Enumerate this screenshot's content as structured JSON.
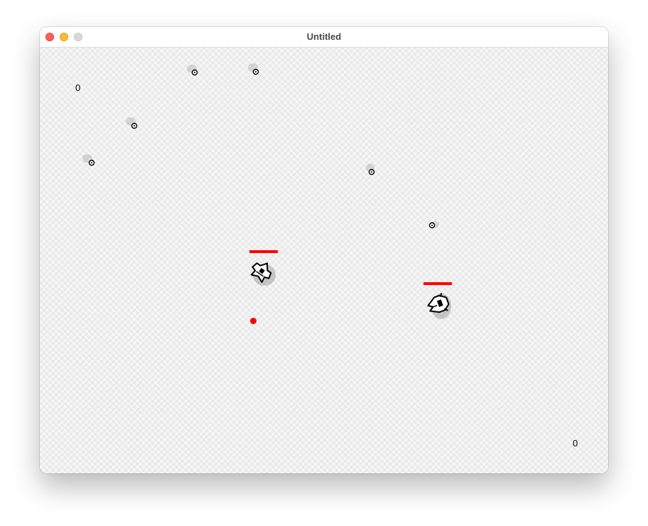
{
  "window": {
    "title": "Untitled"
  },
  "game": {
    "scores": {
      "left": "0",
      "right": "0"
    },
    "players": [
      {
        "id": "player-one",
        "health_bar_color": "#ff0000",
        "health": 1.0
      },
      {
        "id": "player-two",
        "health_bar_color": "#ff0000",
        "health": 1.0
      }
    ],
    "projectile_color": "#ff0000",
    "colors": {
      "background": "#efefef",
      "sprite_outline": "#000000",
      "sprite_fill": "#ffffff"
    }
  }
}
